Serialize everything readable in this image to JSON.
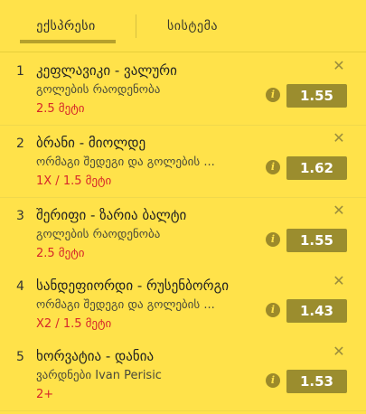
{
  "tabs": {
    "express": "ექსპრესი",
    "system": "სისტემა"
  },
  "bets": [
    {
      "num": "1",
      "match": "კეფლავიკი - ვალური",
      "market": "გოლების რაოდენობა",
      "pick": "2.5 მეტი",
      "odds": "1.55"
    },
    {
      "num": "2",
      "match": "ბრანი - მიოლდე",
      "market": "ორმაგი შედეგი და გოლების ...",
      "pick": "1X / 1.5 მეტი",
      "odds": "1.62"
    },
    {
      "num": "3",
      "match": "შერიფი - ზარია ბალტი",
      "market": "გოლების რაოდენობა",
      "pick": "2.5 მეტი",
      "odds": "1.55"
    },
    {
      "num": "4",
      "match": "სანდეფიორდი - რუსენბორგი",
      "market": "ორმაგი შედეგი და გოლების ...",
      "pick": "X2 / 1.5 მეტი",
      "odds": "1.43"
    },
    {
      "num": "5",
      "match": "ხორვატია - დანია",
      "market": "ვარდნები Ivan Perisic",
      "pick": "2+",
      "odds": "1.53"
    }
  ],
  "icons": {
    "close": "close-icon",
    "info": "info-icon"
  },
  "colors": {
    "background": "#ffe24a",
    "odds_bg": "#9b8d2e",
    "pick": "#d6262a"
  }
}
